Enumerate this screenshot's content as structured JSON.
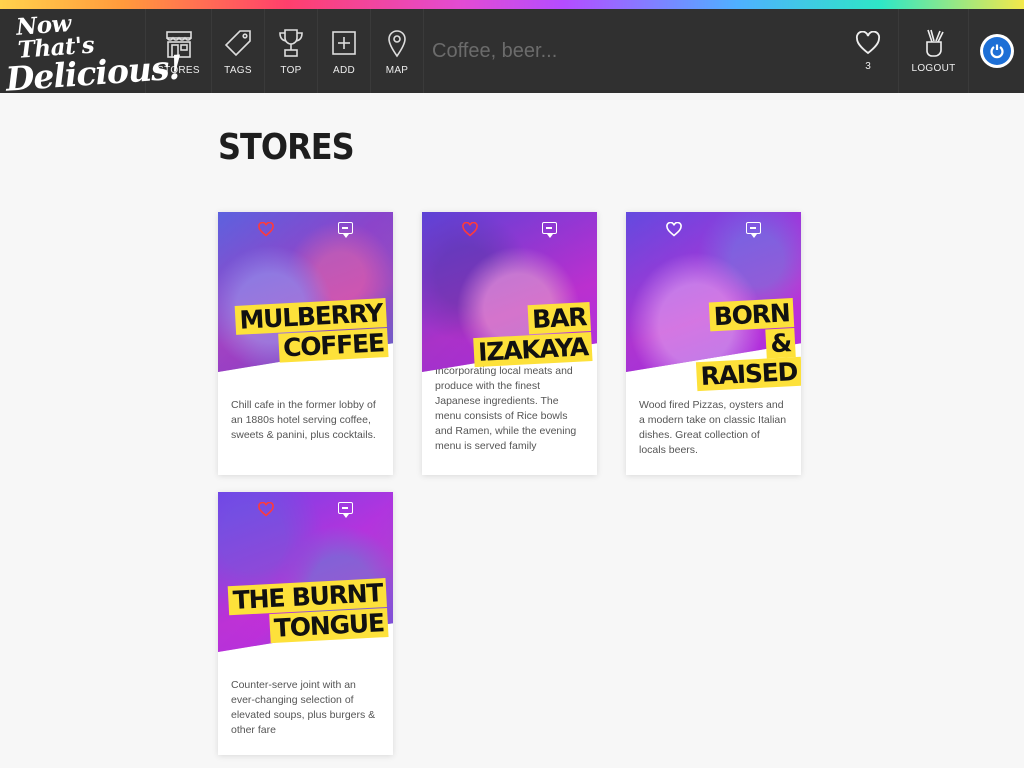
{
  "app": {
    "logo_line1": "Now That's",
    "logo_line2": "Delicious!"
  },
  "nav": {
    "items": [
      {
        "label": "STORES",
        "icon": "store-icon"
      },
      {
        "label": "TAGS",
        "icon": "tag-icon"
      },
      {
        "label": "TOP",
        "icon": "trophy-icon"
      },
      {
        "label": "ADD",
        "icon": "add-icon"
      },
      {
        "label": "MAP",
        "icon": "map-pin-icon"
      }
    ],
    "search_placeholder": "Coffee, beer...",
    "hearts_count": "3",
    "logout_label": "LOGOUT"
  },
  "page": {
    "title": "STORES"
  },
  "stores": [
    {
      "name": "MULBERRY COFFEE",
      "description": "Chill cafe in the former lobby of an 1880s hotel serving coffee, sweets & panini, plus cocktails.",
      "hearted": true
    },
    {
      "name": "BAR IZAKAYA",
      "description": "Incorporating local meats and produce with the finest Japanese ingredients. The menu consists of Rice bowls and Ramen, while the evening menu is served family",
      "hearted": true
    },
    {
      "name": "BORN & RAISED",
      "description": "Wood fired Pizzas, oysters and a modern take on classic Italian dishes. Great collection of locals beers.",
      "hearted": false
    },
    {
      "name": "THE BURNT TONGUE",
      "description": "Counter-serve joint with an ever-changing selection of elevated soups, plus burgers & other fare",
      "hearted": true
    }
  ],
  "colors": {
    "nav_bg": "#303030",
    "title_highlight": "#fde13a",
    "heart_active": "#ff3a3a",
    "avatar_blue": "#1d6fd6"
  }
}
